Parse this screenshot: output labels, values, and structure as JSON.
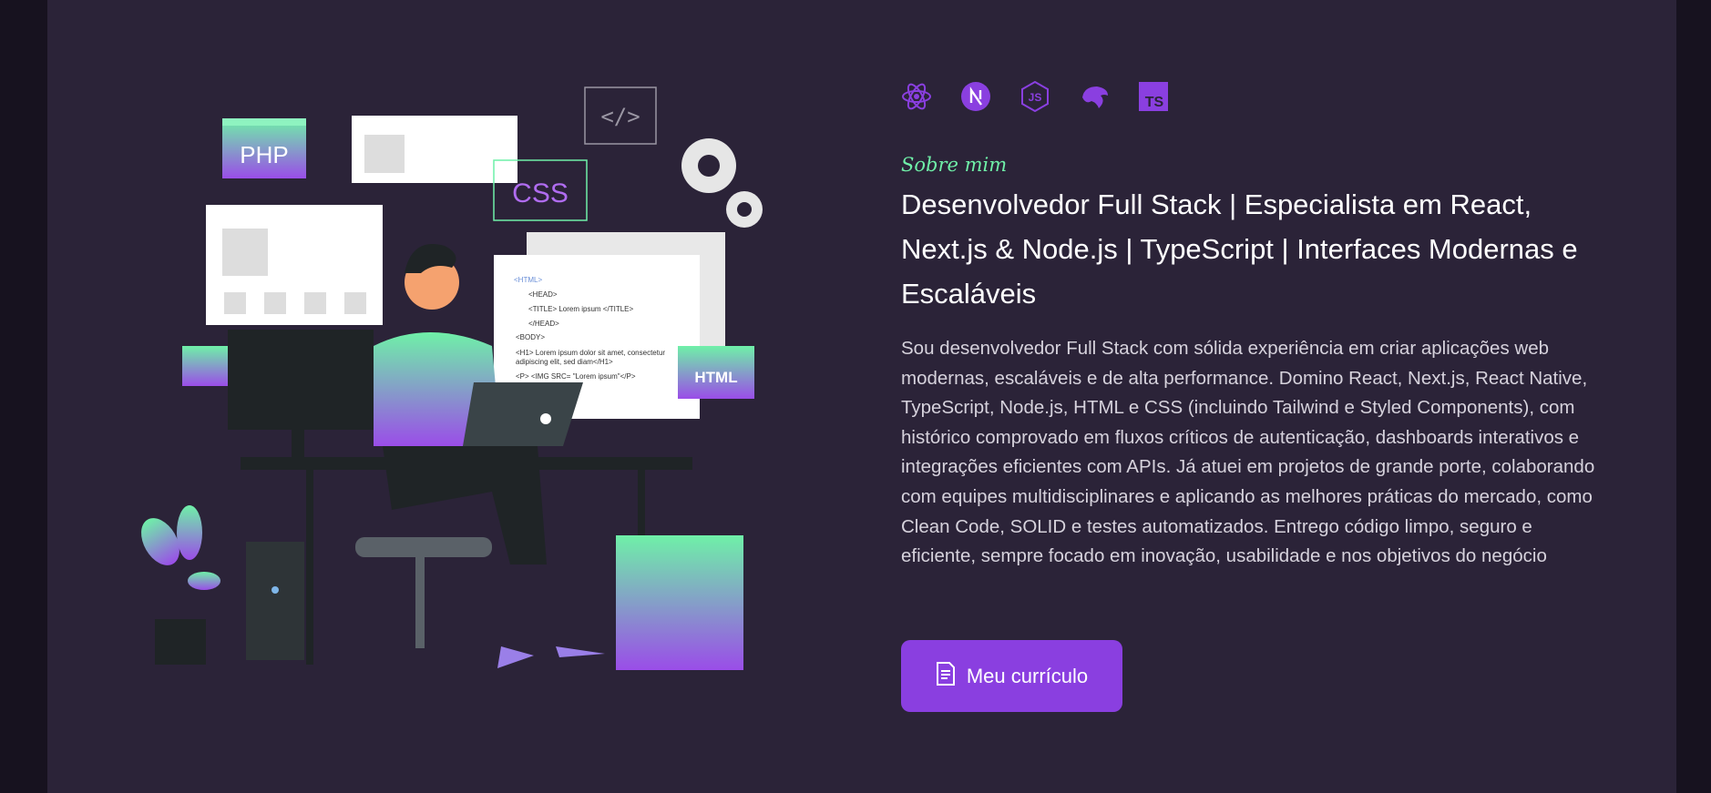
{
  "tech_stack": [
    {
      "icon": "react-icon"
    },
    {
      "icon": "nextjs-icon"
    },
    {
      "icon": "nodejs-icon"
    },
    {
      "icon": "nestjs-icon"
    },
    {
      "icon": "typescript-icon"
    },
    {
      "icon": "tailwind-icon"
    }
  ],
  "about": {
    "eyebrow": "Sobre mim",
    "headline": "Desenvolvedor Full Stack | Especialista em React, Next.js & Node.js | TypeScript | Interfaces Modernas e Escaláveis",
    "bio": "Sou desenvolvedor Full Stack com sólida experiência em criar aplicações web modernas, escaláveis e de alta performance. Domino React, Next.js, React Native, TypeScript, Node.js, HTML e CSS (incluindo Tailwind e Styled Components), com histórico comprovado em fluxos críticos de autenticação, dashboards interativos e integrações eficientes com APIs. Já atuei em projetos de grande porte, colaborando com equipes multidisciplinares e aplicando as melhores práticas do mercado, como Clean Code, SOLID e testes automatizados. Entrego código limpo, seguro e eficiente, sempre focado em inovação, usabilidade e nos objetivos do negócio",
    "cv_button_label": "Meu currículo",
    "cv_button_icon": "document-icon"
  },
  "illustration": {
    "php_label": "PHP",
    "css_label": "CSS",
    "html_label": "HTML",
    "code_lines": [
      "<HTML>",
      "<HEAD>",
      "<TITLE> Lorem ipsum </TITLE>",
      "</HEAD>",
      "<BODY>",
      "<H1> Lorem ipsum dolor sit amet, consectetur",
      "adipiscing elit, sed diam</H1>",
      "<P> <IMG SRC= \"Lorem ipsum\"</P>"
    ]
  },
  "colors": {
    "background": "#2b2338",
    "accent": "#8a3fe0",
    "eyebrow": "#6ff0a8"
  }
}
